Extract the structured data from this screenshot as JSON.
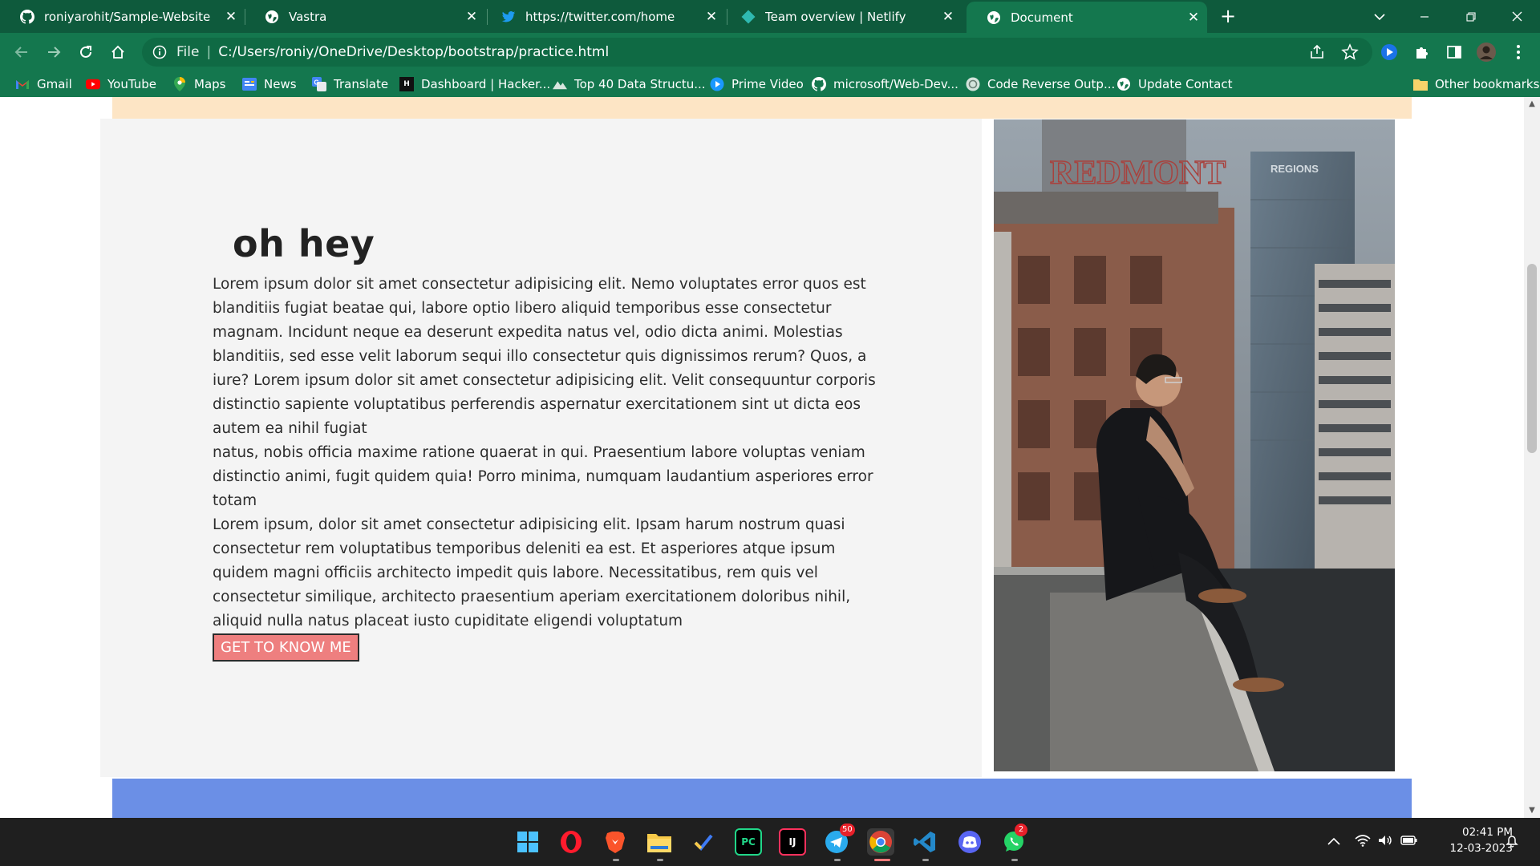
{
  "browser": {
    "tabs": [
      {
        "title": "roniyarohit/Sample-Website",
        "icon": "github-icon",
        "active": false
      },
      {
        "title": "Vastra",
        "icon": "globe-icon",
        "active": false
      },
      {
        "title": "https://twitter.com/home",
        "icon": "twitter-icon",
        "active": false
      },
      {
        "title": "Team overview | Netlify",
        "icon": "netlify-icon",
        "active": false
      },
      {
        "title": "Document",
        "icon": "globe-icon",
        "active": true
      }
    ],
    "new_tab_label": "+",
    "close_glyph": "✕",
    "address": {
      "file_label": "File",
      "url": "C:/Users/roniy/OneDrive/Desktop/bootstrap/practice.html"
    },
    "bookmarks": [
      {
        "label": "Gmail",
        "icon": "gmail-icon"
      },
      {
        "label": "YouTube",
        "icon": "youtube-icon"
      },
      {
        "label": "Maps",
        "icon": "maps-icon"
      },
      {
        "label": "News",
        "icon": "news-icon"
      },
      {
        "label": "Translate",
        "icon": "translate-icon"
      },
      {
        "label": "Dashboard | Hacker...",
        "icon": "hackerrank-icon"
      },
      {
        "label": "Top 40 Data Structu...",
        "icon": "mountain-icon"
      },
      {
        "label": "Prime Video",
        "icon": "prime-video-icon"
      },
      {
        "label": "microsoft/Web-Dev...",
        "icon": "github-icon"
      },
      {
        "label": "Code Reverse Outp...",
        "icon": "chatgpt-icon"
      },
      {
        "label": "Update Contact",
        "icon": "globe-icon"
      }
    ],
    "other_bookmarks": "Other bookmarks"
  },
  "page": {
    "heading": "oh hey",
    "paragraphs": [
      "Lorem ipsum dolor sit amet consectetur adipisicing elit. Nemo voluptates error quos est blanditiis fugiat beatae qui, labore optio libero aliquid temporibus esse consectetur magnam. Incidunt neque ea deserunt expedita natus vel, odio dicta animi. Molestias blanditiis, sed esse velit laborum sequi illo consectetur quis dignissimos rerum? Quos, a iure? Lorem ipsum dolor sit amet consectetur adipisicing elit. Velit consequuntur corporis distinctio sapiente voluptatibus perferendis aspernatur exercitationem sint ut dicta eos autem ea nihil fugiat",
      "natus, nobis officia maxime ratione quaerat in qui. Praesentium labore voluptas veniam distinctio animi, fugit quidem quia! Porro minima, numquam laudantium asperiores error totam",
      "Lorem ipsum, dolor sit amet consectetur adipisicing elit. Ipsam harum nostrum quasi consectetur rem voluptatibus temporibus deleniti ea est. Et asperiores atque ipsum quidem magni officiis architecto impedit quis labore. Necessitatibus, rem quis vel consectetur similique, architecto praesentium aperiam exercitationem doloribus nihil, aliquid nulla natus placeat iusto cupiditate eligendi voluptatum"
    ],
    "cta_label": "GET TO KNOW ME",
    "photo": {
      "sign_text": "REDMONT",
      "building_sign": "REGIONS"
    },
    "colors": {
      "peach_strip": "#fde5c5",
      "card_bg": "#f4f4f4",
      "cta_bg": "#ee7f7f",
      "blue_strip": "#6b8fe6",
      "chrome_green": "#14774e"
    }
  },
  "taskbar": {
    "apps": [
      {
        "name": "windows-start-icon"
      },
      {
        "name": "opera-icon"
      },
      {
        "name": "brave-icon"
      },
      {
        "name": "file-explorer-icon"
      },
      {
        "name": "todo-icon"
      },
      {
        "name": "pycharm-icon",
        "label": "PC"
      },
      {
        "name": "intellij-icon",
        "label": "IJ"
      },
      {
        "name": "telegram-icon",
        "badge": "50"
      },
      {
        "name": "chrome-icon"
      },
      {
        "name": "vscode-icon"
      },
      {
        "name": "discord-icon"
      },
      {
        "name": "whatsapp-icon",
        "badge": "2"
      }
    ],
    "time": "02:41 PM",
    "date": "12-03-2023"
  }
}
